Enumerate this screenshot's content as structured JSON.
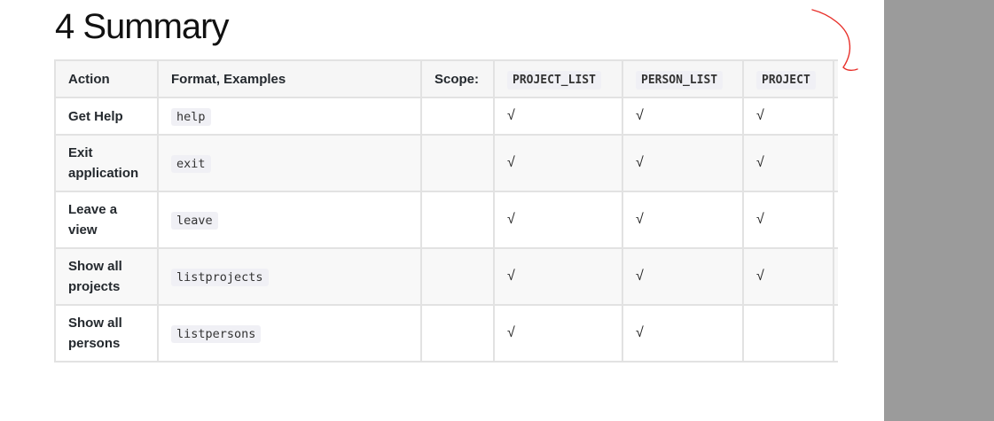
{
  "heading": "4 Summary",
  "table": {
    "headers": [
      "Action",
      "Format, Examples",
      "Scope:",
      "PROJECT_LIST",
      "PERSON_LIST",
      "PROJECT"
    ],
    "rows": [
      {
        "action": "Get Help",
        "format": "help",
        "scope": "",
        "project_list": "√",
        "person_list": "√",
        "project": "√"
      },
      {
        "action": "Exit application",
        "format": "exit",
        "scope": "",
        "project_list": "√",
        "person_list": "√",
        "project": "√"
      },
      {
        "action": "Leave a view",
        "format": "leave",
        "scope": "",
        "project_list": "√",
        "person_list": "√",
        "project": "√"
      },
      {
        "action": "Show all projects",
        "format": "listprojects",
        "scope": "",
        "project_list": "√",
        "person_list": "√",
        "project": "√"
      },
      {
        "action": "Show all persons",
        "format": "listpersons",
        "scope": "",
        "project_list": "√",
        "person_list": "√",
        "project": ""
      }
    ]
  },
  "colors": {
    "annotation": "#e8302a",
    "gutter": "#9b9b9b"
  }
}
